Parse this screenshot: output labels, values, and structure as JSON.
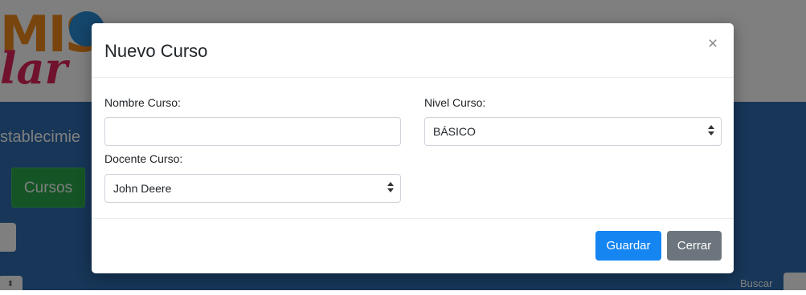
{
  "background": {
    "logo_top": "MIS",
    "logo_bottom": "lar",
    "establecimiento_text": "stablecimie",
    "cursos_button": "Cursos",
    "buscar_label": "Buscar"
  },
  "modal": {
    "title": "Nuevo Curso",
    "close_icon": "close-icon",
    "fields": {
      "nombre_label": "Nombre Curso:",
      "nombre_value": "",
      "nivel_label": "Nivel Curso:",
      "nivel_value": "BÁSICO",
      "docente_label": "Docente Curso:",
      "docente_value": "John Deere"
    },
    "buttons": {
      "guardar": "Guardar",
      "cerrar": "Cerrar"
    }
  },
  "colors": {
    "primary": "#1585f2",
    "secondary": "#6c757d",
    "band": "#2f6db0",
    "cursos_green": "#2aa84a"
  }
}
